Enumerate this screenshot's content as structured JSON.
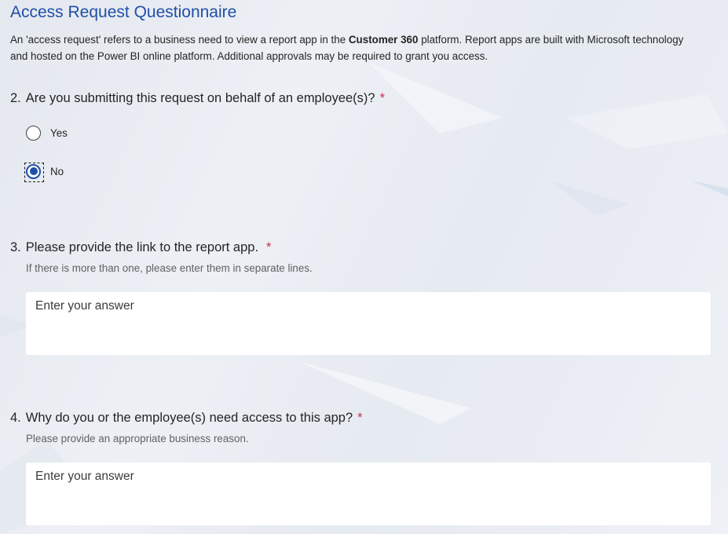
{
  "form": {
    "title": "Access Request Questionnaire",
    "intro_part1": "An 'access request' refers to a business need to view a report app in the ",
    "intro_bold": "Customer 360",
    "intro_part2": " platform. Report apps are built with Microsoft technology and hosted on the Power BI online platform. Additional approvals may be required to grant you access."
  },
  "questions": [
    {
      "number": "2.",
      "text": "Are you submitting this request on behalf of an employee(s)?",
      "required_mark": "*",
      "options": [
        {
          "label": "Yes",
          "selected": false
        },
        {
          "label": "No",
          "selected": true
        }
      ]
    },
    {
      "number": "3.",
      "text": "Please provide the link to the report app.",
      "required_mark": "*",
      "subtitle": "If there is more than one, please enter them in separate lines.",
      "placeholder": "Enter your answer"
    },
    {
      "number": "4.",
      "text": "Why do you or the employee(s) need access to this app?",
      "required_mark": "*",
      "subtitle": "Please provide an appropriate business reason.",
      "placeholder": "Enter your answer"
    }
  ],
  "colors": {
    "accent": "#1f4fa8",
    "required": "#c4314b",
    "background": "#e8ebf1"
  }
}
